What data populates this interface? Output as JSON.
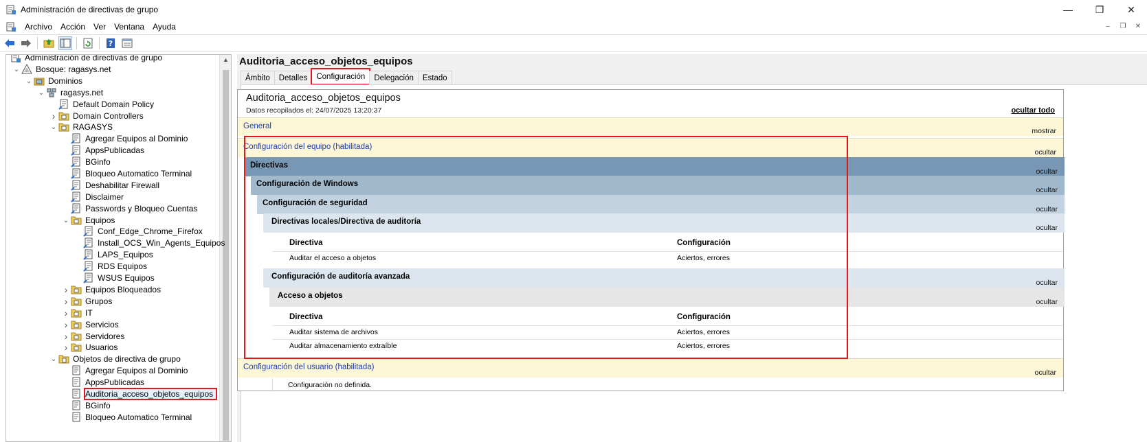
{
  "window": {
    "title": "Administración de directivas de grupo",
    "controls": [
      "—",
      "❐",
      "✕"
    ]
  },
  "menu": [
    "Archivo",
    "Acción",
    "Ver",
    "Ventana",
    "Ayuda"
  ],
  "mdi_controls": [
    "–",
    "❐",
    "✕"
  ],
  "toolbar": {
    "icons": [
      "back-arrow-icon",
      "forward-arrow-icon",
      "up-folder-icon",
      "show-hide-tree-icon",
      "refresh-icon",
      "help-icon",
      "properties-icon"
    ]
  },
  "tree": {
    "items": [
      {
        "label": "Administración de directivas de grupo",
        "level": 0,
        "expander": "",
        "icon": "gpmc"
      },
      {
        "label": "Bosque: ragasys.net",
        "level": 1,
        "expander": "v",
        "icon": "forest"
      },
      {
        "label": "Dominios",
        "level": 2,
        "expander": "v",
        "icon": "domains"
      },
      {
        "label": "ragasys.net",
        "level": 3,
        "expander": "v",
        "icon": "domain"
      },
      {
        "label": "Default Domain Policy",
        "level": 4,
        "expander": "",
        "icon": "gpo-link"
      },
      {
        "label": "Domain Controllers",
        "level": 4,
        "expander": ">",
        "icon": "ou"
      },
      {
        "label": "RAGASYS",
        "level": 4,
        "expander": "v",
        "icon": "ou"
      },
      {
        "label": "Agregar Equipos al Dominio",
        "level": 5,
        "expander": "",
        "icon": "gpo-link"
      },
      {
        "label": "AppsPublicadas",
        "level": 5,
        "expander": "",
        "icon": "gpo-link"
      },
      {
        "label": "BGinfo",
        "level": 5,
        "expander": "",
        "icon": "gpo-link"
      },
      {
        "label": "Bloqueo Automatico Terminal",
        "level": 5,
        "expander": "",
        "icon": "gpo-link"
      },
      {
        "label": "Deshabilitar Firewall",
        "level": 5,
        "expander": "",
        "icon": "gpo-link"
      },
      {
        "label": "Disclaimer",
        "level": 5,
        "expander": "",
        "icon": "gpo-link"
      },
      {
        "label": "Passwords y Bloqueo Cuentas",
        "level": 5,
        "expander": "",
        "icon": "gpo-link"
      },
      {
        "label": "Equipos",
        "level": 5,
        "expander": "v",
        "icon": "ou"
      },
      {
        "label": "Conf_Edge_Chrome_Firefox",
        "level": 6,
        "expander": "",
        "icon": "gpo-link"
      },
      {
        "label": "Install_OCS_Win_Agents_Equipos",
        "level": 6,
        "expander": "",
        "icon": "gpo-link"
      },
      {
        "label": "LAPS_Equipos",
        "level": 6,
        "expander": "",
        "icon": "gpo-link"
      },
      {
        "label": "RDS Equipos",
        "level": 6,
        "expander": "",
        "icon": "gpo-link"
      },
      {
        "label": "WSUS Equipos",
        "level": 6,
        "expander": "",
        "icon": "gpo-link"
      },
      {
        "label": "Equipos Bloqueados",
        "level": 5,
        "expander": ">",
        "icon": "ou"
      },
      {
        "label": "Grupos",
        "level": 5,
        "expander": ">",
        "icon": "ou"
      },
      {
        "label": "IT",
        "level": 5,
        "expander": ">",
        "icon": "ou"
      },
      {
        "label": "Servicios",
        "level": 5,
        "expander": ">",
        "icon": "ou"
      },
      {
        "label": "Servidores",
        "level": 5,
        "expander": ">",
        "icon": "ou"
      },
      {
        "label": "Usuarios",
        "level": 5,
        "expander": ">",
        "icon": "ou"
      },
      {
        "label": "Objetos de directiva de grupo",
        "level": 4,
        "expander": "v",
        "icon": "gpo-container"
      },
      {
        "label": "Agregar Equipos al Dominio",
        "level": 5,
        "expander": "",
        "icon": "gpo"
      },
      {
        "label": "AppsPublicadas",
        "level": 5,
        "expander": "",
        "icon": "gpo"
      },
      {
        "label": "Auditoria_acceso_objetos_equipos",
        "level": 5,
        "expander": "",
        "icon": "gpo",
        "selected": true
      },
      {
        "label": "BGinfo",
        "level": 5,
        "expander": "",
        "icon": "gpo"
      },
      {
        "label": "Bloqueo Automatico Terminal",
        "level": 5,
        "expander": "",
        "icon": "gpo"
      }
    ]
  },
  "right": {
    "title": "Auditoria_acceso_objetos_equipos",
    "tabs": [
      {
        "label": "Ámbito",
        "active": false
      },
      {
        "label": "Detalles",
        "active": false
      },
      {
        "label": "Configuración",
        "active": true
      },
      {
        "label": "Delegación",
        "active": false
      },
      {
        "label": "Estado",
        "active": false
      }
    ],
    "report": {
      "title": "Auditoria_acceso_objetos_equipos",
      "date": "Datos recopilados el: 24/07/2025 13:20:37",
      "hide_all": "ocultar todo",
      "general": "General",
      "show": "mostrar",
      "hide": "ocultar",
      "computer_config": "Configuración del equipo (habilitada)",
      "policies": "Directivas",
      "windows_config": "Configuración de Windows",
      "security_config": "Configuración de seguridad",
      "local_audit": "Directivas locales/Directiva de auditoría",
      "col_policy": "Directiva",
      "col_setting": "Configuración",
      "local_rows": [
        {
          "policy": "Auditar el acceso a objetos",
          "setting": "Aciertos, errores"
        }
      ],
      "advanced_audit": "Configuración de auditoría avanzada",
      "object_access": "Acceso a objetos",
      "advanced_rows": [
        {
          "policy": "Auditar sistema de archivos",
          "setting": "Aciertos, errores"
        },
        {
          "policy": "Auditar almacenamiento extraíble",
          "setting": "Aciertos, errores"
        }
      ],
      "user_config": "Configuración del usuario (habilitada)",
      "not_defined": "Configuración no definida."
    }
  }
}
